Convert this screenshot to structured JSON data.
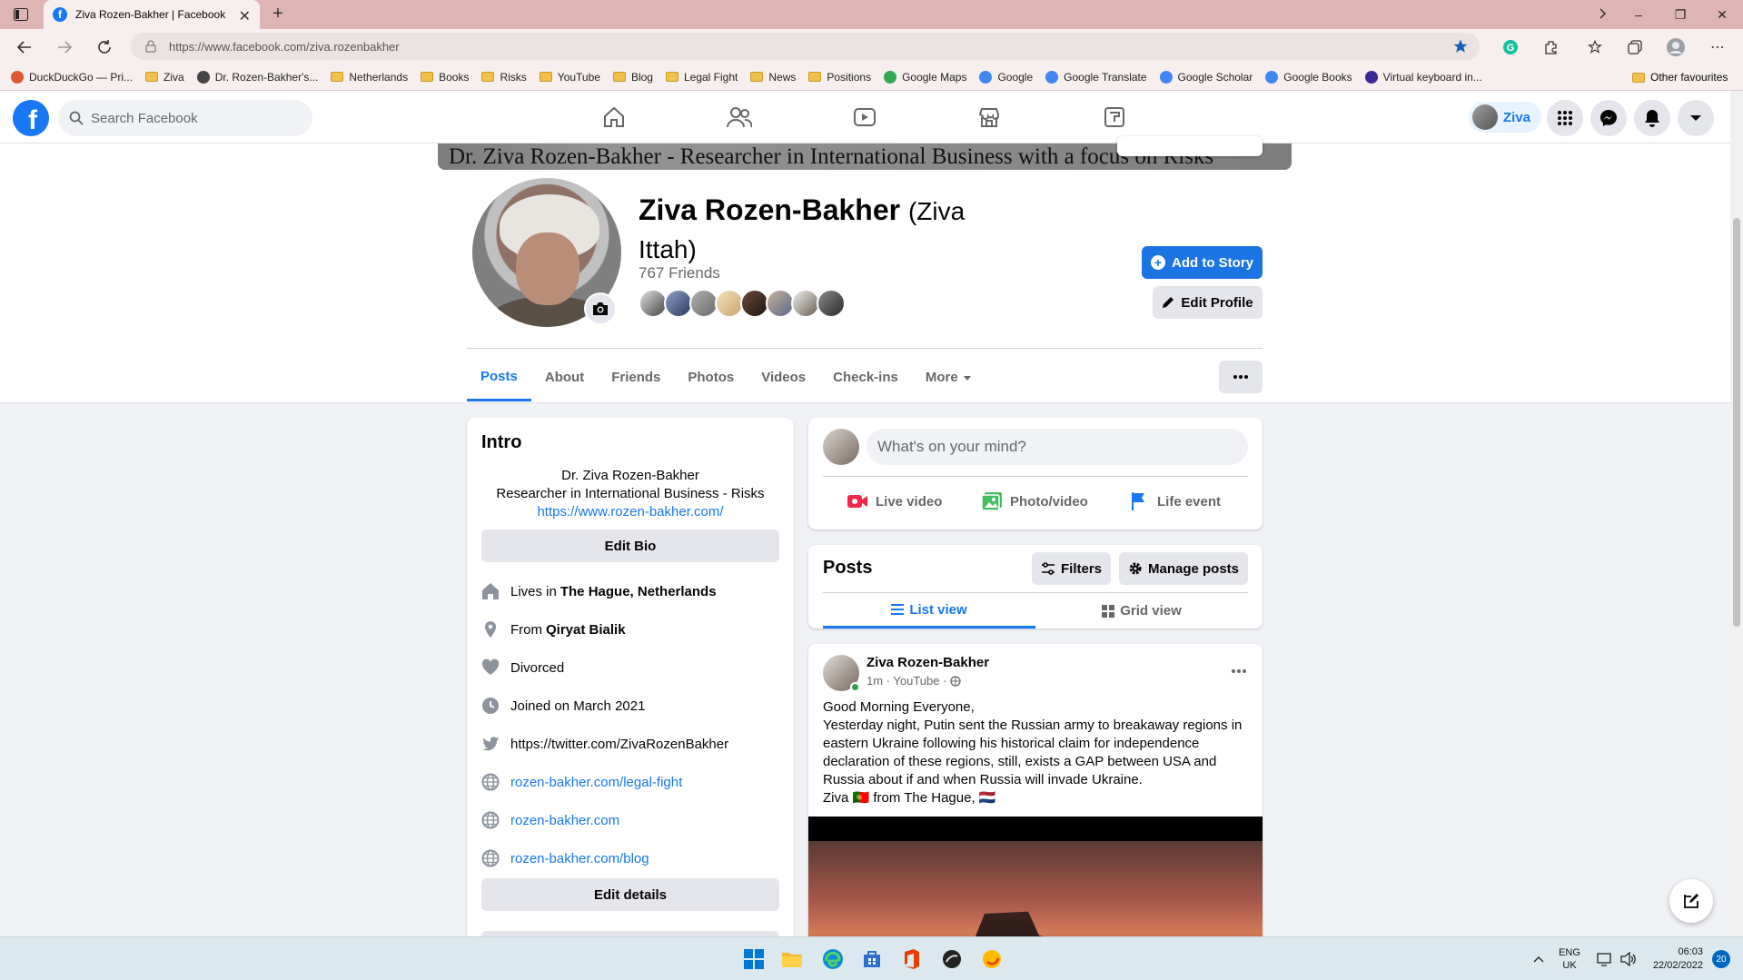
{
  "browser": {
    "tab_title": "Ziva Rozen-Bakher | Facebook",
    "tab_close": "✕",
    "new_tab": "+",
    "url": "https://www.facebook.com/ziva.rozenbakher",
    "window_controls": [
      "–",
      "❐",
      "✕"
    ]
  },
  "bookmarks": [
    {
      "label": "DuckDuckGo — Pri...",
      "icon": "duckduckgo-icon",
      "color": "#de5833"
    },
    {
      "label": "Ziva",
      "icon": "folder-icon"
    },
    {
      "label": "Dr. Rozen-Bakher's...",
      "icon": "cube-icon",
      "color": "#444444"
    },
    {
      "label": "Netherlands",
      "icon": "folder-icon"
    },
    {
      "label": "Books",
      "icon": "folder-icon"
    },
    {
      "label": "Risks",
      "icon": "folder-icon"
    },
    {
      "label": "YouTube",
      "icon": "folder-icon"
    },
    {
      "label": "Blog",
      "icon": "folder-icon"
    },
    {
      "label": "Legal Fight",
      "icon": "folder-icon"
    },
    {
      "label": "News",
      "icon": "folder-icon"
    },
    {
      "label": "Positions",
      "icon": "folder-icon"
    },
    {
      "label": "Google Maps",
      "icon": "maps-pin-icon",
      "color": "#34a853"
    },
    {
      "label": "Google",
      "icon": "google-icon",
      "color": "#4285f4"
    },
    {
      "label": "Google Translate",
      "icon": "translate-icon",
      "color": "#4285f4"
    },
    {
      "label": "Google Scholar",
      "icon": "scholar-icon",
      "color": "#4285f4"
    },
    {
      "label": "Google Books",
      "icon": "google-icon",
      "color": "#4285f4"
    },
    {
      "label": "Virtual keyboard in...",
      "icon": "keyboard-icon",
      "color": "#3b2a96"
    }
  ],
  "bookmarks_other": "Other favourites",
  "fb": {
    "search_placeholder": "Search Facebook",
    "me_name": "Ziva",
    "brand_color": "#1877f2"
  },
  "profile": {
    "cover_text": "Dr. Ziva Rozen-Bakher - Researcher in International Business with a focus on Risks",
    "name": "Ziva Rozen-Bakher",
    "alt_name": "(Ziva Ittah)",
    "friends": "767 Friends",
    "add_story": "Add to Story",
    "edit_profile": "Edit Profile",
    "tabs": [
      "Posts",
      "About",
      "Friends",
      "Photos",
      "Videos",
      "Check-ins",
      "More"
    ]
  },
  "intro": {
    "title": "Intro",
    "bio_line1": "Dr. Ziva Rozen-Bakher",
    "bio_line2": "Researcher in International Business - Risks",
    "bio_link": "https://www.rozen-bakher.com/",
    "edit_bio": "Edit Bio",
    "lives_prefix": "Lives in",
    "lives": "The Hague, Netherlands",
    "from_prefix": "From",
    "from": "Qiryat Bialik",
    "relationship": "Divorced",
    "joined": "Joined on March 2021",
    "twitter": "https://twitter.com/ZivaRozenBakher",
    "link1": "rozen-bakher.com/legal-fight",
    "link2": "rozen-bakher.com",
    "link3": "rozen-bakher.com/blog",
    "edit_details": "Edit details"
  },
  "composer": {
    "placeholder": "What's on your mind?",
    "live": "Live video",
    "photo": "Photo/video",
    "life": "Life event"
  },
  "posts_header": {
    "title": "Posts",
    "filters": "Filters",
    "manage": "Manage posts",
    "list_view": "List view",
    "grid_view": "Grid view"
  },
  "post": {
    "author": "Ziva Rozen-Bakher",
    "meta": "1m · YouTube ·",
    "line1": "Good Morning Everyone,",
    "line2": "Yesterday night, Putin sent the Russian army to breakaway regions in eastern Ukraine following his historical claim for independence declaration of these regions, still, exists a GAP between USA and Russia about if and when Russia will invade Ukraine.",
    "line3": "Ziva 🇵🇹 from The Hague, 🇳🇱"
  },
  "taskbar": {
    "lang1": "ENG",
    "lang2": "UK",
    "time": "06:03",
    "date": "22/02/2022",
    "notifications": "20"
  }
}
